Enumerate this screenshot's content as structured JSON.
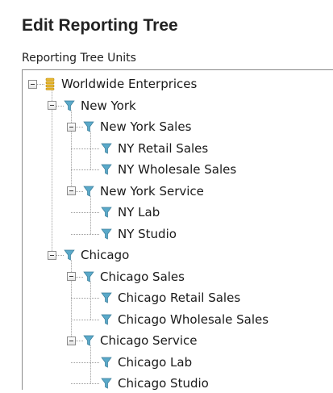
{
  "header": {
    "title": "Edit Reporting Tree",
    "subtitle": "Reporting Tree Units"
  },
  "colors": {
    "root_icon": "#e8b830",
    "unit_icon": "#5aa9c9",
    "connector": "#9a9a9a"
  },
  "tree": {
    "label": "Worldwide Enterprices",
    "icon": "stacked-coins-icon",
    "expanded": true,
    "children": [
      {
        "label": "New York",
        "icon": "filter-funnel-icon",
        "expanded": true,
        "children": [
          {
            "label": "New York Sales",
            "icon": "filter-funnel-icon",
            "expanded": true,
            "children": [
              {
                "label": "NY Retail Sales",
                "icon": "filter-funnel-icon"
              },
              {
                "label": "NY Wholesale Sales",
                "icon": "filter-funnel-icon"
              }
            ]
          },
          {
            "label": "New York Service",
            "icon": "filter-funnel-icon",
            "expanded": true,
            "children": [
              {
                "label": "NY Lab",
                "icon": "filter-funnel-icon"
              },
              {
                "label": "NY Studio",
                "icon": "filter-funnel-icon"
              }
            ]
          }
        ]
      },
      {
        "label": "Chicago",
        "icon": "filter-funnel-icon",
        "expanded": true,
        "children": [
          {
            "label": "Chicago Sales",
            "icon": "filter-funnel-icon",
            "expanded": true,
            "children": [
              {
                "label": "Chicago Retail Sales",
                "icon": "filter-funnel-icon"
              },
              {
                "label": "Chicago Wholesale Sales",
                "icon": "filter-funnel-icon"
              }
            ]
          },
          {
            "label": "Chicago Service",
            "icon": "filter-funnel-icon",
            "expanded": true,
            "children": [
              {
                "label": "Chicago Lab",
                "icon": "filter-funnel-icon"
              },
              {
                "label": "Chicago Studio",
                "icon": "filter-funnel-icon"
              }
            ]
          }
        ]
      }
    ]
  }
}
